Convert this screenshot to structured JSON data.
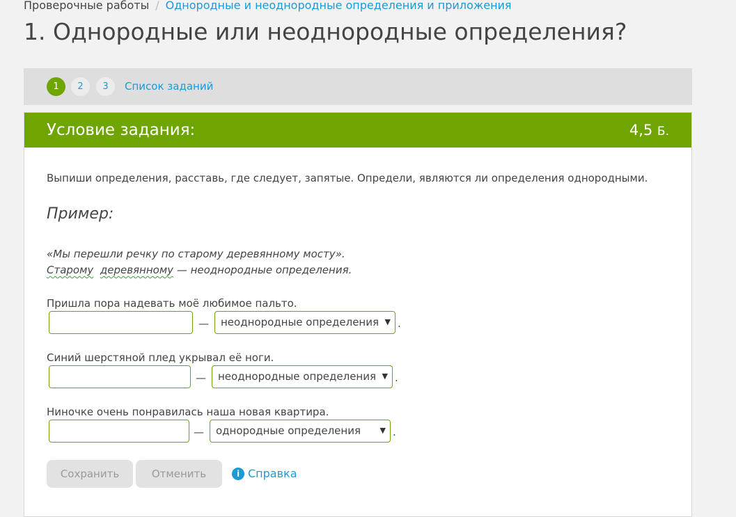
{
  "breadcrumb": {
    "root": "Проверочные работы",
    "separator": "/",
    "current": "Однородные и неоднородные определения и приложения"
  },
  "page_title": "1. Однородные или неоднородные определения?",
  "steps": [
    "1",
    "2",
    "3"
  ],
  "active_step": "1",
  "task_list_label": "Список заданий",
  "task": {
    "header_title": "Условие задания:",
    "score": "4,5",
    "score_unit": "Б.",
    "instructions": "Выпиши определения, расставь, где следует, запятые. Определи, являются ли определения однородными.",
    "example_heading": "Пример:",
    "example_sentence": "«Мы перешли речку по старому деревянному мосту».",
    "example_word1": "Старому",
    "example_word2": "деревянному",
    "example_tail": "— неоднородные определения."
  },
  "exercises": [
    {
      "sentence": "Пришла пора надевать моё любимое пальто.",
      "input_value": "",
      "dash": "—",
      "selected": "неоднородные определения",
      "period": "."
    },
    {
      "sentence": "Синий шерстяной плед укрывал её ноги.",
      "input_value": "",
      "dash": "—",
      "selected": "неоднородные определения",
      "period": "."
    },
    {
      "sentence": "Ниночке очень понравилась наша новая квартира.",
      "input_value": "",
      "dash": "—",
      "selected": "однородные определения",
      "period": "."
    }
  ],
  "buttons": {
    "save": "Сохранить",
    "cancel": "Отменить",
    "help": "Справка"
  },
  "colors": {
    "accent_green": "#6ea500",
    "link_blue": "#1a9ad8",
    "page_bg": "#f2f2f2",
    "button_disabled": "#e2e2e2"
  },
  "icons": {
    "help": "info-circle-icon",
    "select": "chevron-down-icon"
  }
}
